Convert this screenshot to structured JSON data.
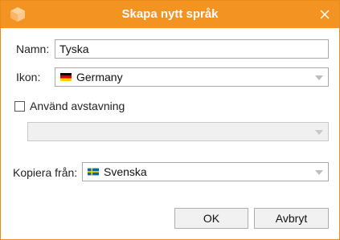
{
  "dialog": {
    "title": "Skapa nytt språk",
    "accent_color": "#f39322",
    "icons": {
      "app": "cube-icon",
      "close": "close-icon"
    }
  },
  "form": {
    "name_label": "Namn:",
    "name_value": "Tyska",
    "icon_label": "Ikon:",
    "icon_value": "Germany",
    "icon_flag": "germany-flag-icon",
    "hyphenation_label": "Använd avstavning",
    "hyphenation_checked": false,
    "hyphenation_select_value": "",
    "copy_from_label": "Kopiera från:",
    "copy_from_value": "Svenska",
    "copy_from_flag": "sweden-flag-icon"
  },
  "buttons": {
    "ok": "OK",
    "cancel": "Avbryt"
  }
}
